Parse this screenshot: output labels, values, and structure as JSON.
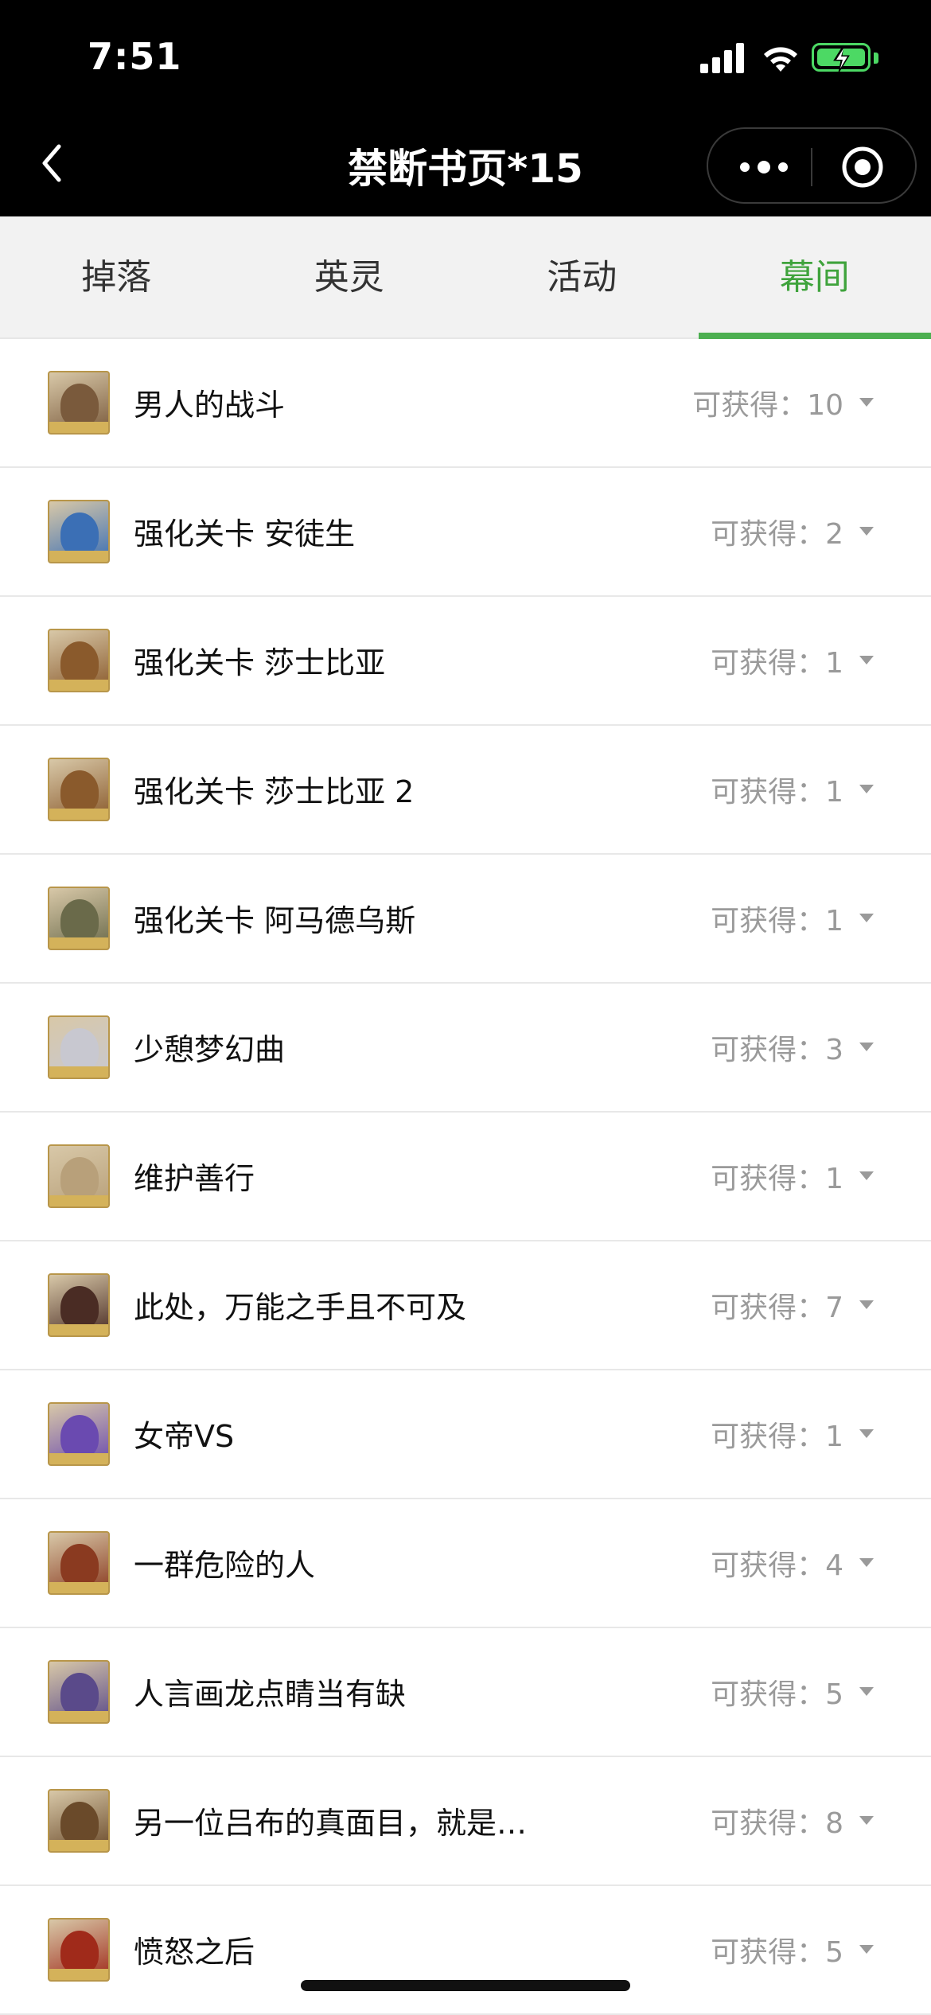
{
  "status_bar": {
    "time": "7:51"
  },
  "nav": {
    "title": "禁断书页*15"
  },
  "tabs": [
    {
      "label": "掉落",
      "active": false
    },
    {
      "label": "英灵",
      "active": false
    },
    {
      "label": "活动",
      "active": false
    },
    {
      "label": "幕间",
      "active": true
    }
  ],
  "colors": {
    "accent": "#3fa33c",
    "battery": "#4cd964"
  },
  "items": [
    {
      "title": "男人的战斗",
      "count_label": "可获得：10",
      "avatar_color": "#7a5a3c"
    },
    {
      "title": "强化关卡 安徒生",
      "count_label": "可获得：2",
      "avatar_color": "#3b6fb5"
    },
    {
      "title": "强化关卡 莎士比亚",
      "count_label": "可获得：1",
      "avatar_color": "#8a5a2c"
    },
    {
      "title": "强化关卡 莎士比亚 2",
      "count_label": "可获得：1",
      "avatar_color": "#8a5a2c"
    },
    {
      "title": "强化关卡 阿马德乌斯",
      "count_label": "可获得：1",
      "avatar_color": "#6a6a4a"
    },
    {
      "title": "少憩梦幻曲",
      "count_label": "可获得：3",
      "avatar_color": "#c8c8d0"
    },
    {
      "title": "维护善行",
      "count_label": "可获得：1",
      "avatar_color": "#b8a07a"
    },
    {
      "title": "此处，万能之手且不可及",
      "count_label": "可获得：7",
      "avatar_color": "#4a2c24"
    },
    {
      "title": "女帝VS",
      "count_label": "可获得：1",
      "avatar_color": "#6a4ab0"
    },
    {
      "title": "一群危险的人",
      "count_label": "可获得：4",
      "avatar_color": "#8a3a20"
    },
    {
      "title": "人言画龙点睛当有缺",
      "count_label": "可获得：5",
      "avatar_color": "#5a4a8a"
    },
    {
      "title": "另一位吕布的真面目，就是…",
      "count_label": "可获得：8",
      "avatar_color": "#6a4a2a"
    },
    {
      "title": "愤怒之后",
      "count_label": "可获得：5",
      "avatar_color": "#a02a1a"
    }
  ]
}
